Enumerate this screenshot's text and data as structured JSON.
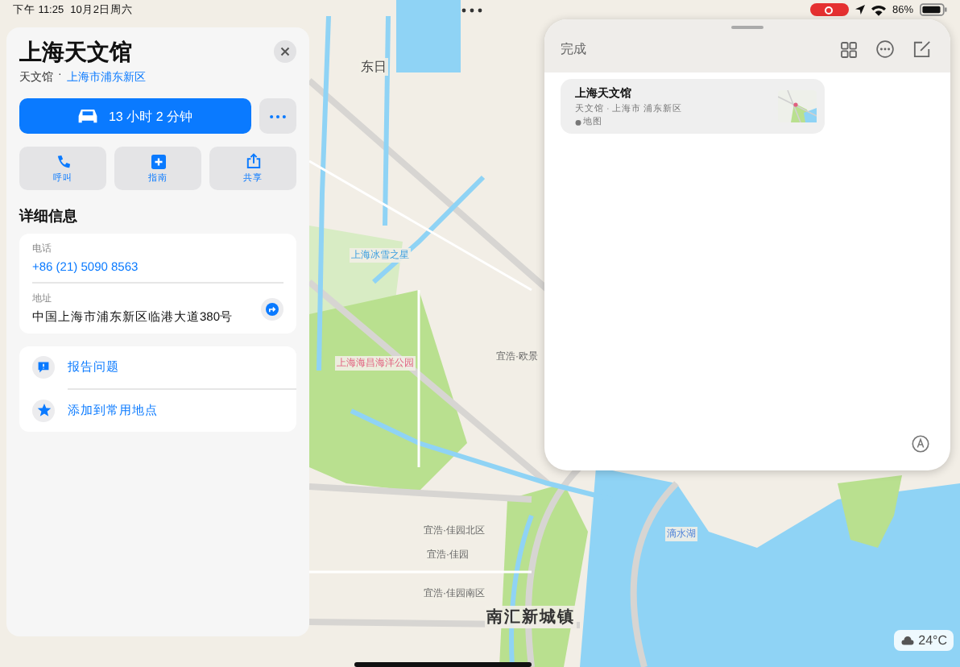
{
  "status_bar": {
    "time": "下午 11:25",
    "date": "10月2日周六",
    "battery": "86%"
  },
  "map": {
    "labels": [
      {
        "text": "东日",
        "kind": "area"
      },
      {
        "text": "上海冰雪之星",
        "kind": "poi"
      },
      {
        "text": "上海海昌海洋公园",
        "kind": "park"
      },
      {
        "text": "宜浩·欧景",
        "kind": "estate"
      },
      {
        "text": "宜浩·佳园北区",
        "kind": "estate"
      },
      {
        "text": "宜浩·佳园",
        "kind": "estate"
      },
      {
        "text": "宜浩·佳园南区",
        "kind": "estate"
      },
      {
        "text": "南汇新城镇",
        "kind": "town"
      },
      {
        "text": "滴水湖",
        "kind": "water"
      }
    ],
    "weather": "24°C"
  },
  "place_card": {
    "title": "上海天文馆",
    "category": "天文馆",
    "separator": "·",
    "location": "上海市浦东新区",
    "route_button": "13 小时 2 分钟",
    "actions": [
      {
        "label": "呼叫",
        "kind": "phone"
      },
      {
        "label": "指南",
        "kind": "guide"
      },
      {
        "label": "共享",
        "kind": "share"
      }
    ],
    "details_heading": "详细信息",
    "details": [
      {
        "label": "电话",
        "value": "+86 (21) 5090 8563",
        "kind": "link"
      },
      {
        "label": "地址",
        "value": "中国上海市浦东新区临港大道380号",
        "kind": "address"
      }
    ],
    "links": [
      {
        "label": "报告问题",
        "kind": "report"
      },
      {
        "label": "添加到常用地点",
        "kind": "favorite"
      }
    ]
  },
  "notes": {
    "done": "完成",
    "note": {
      "title": "上海天文馆",
      "subtitle": "天文馆 · 上海市 浦东新区",
      "source": "地图"
    }
  }
}
